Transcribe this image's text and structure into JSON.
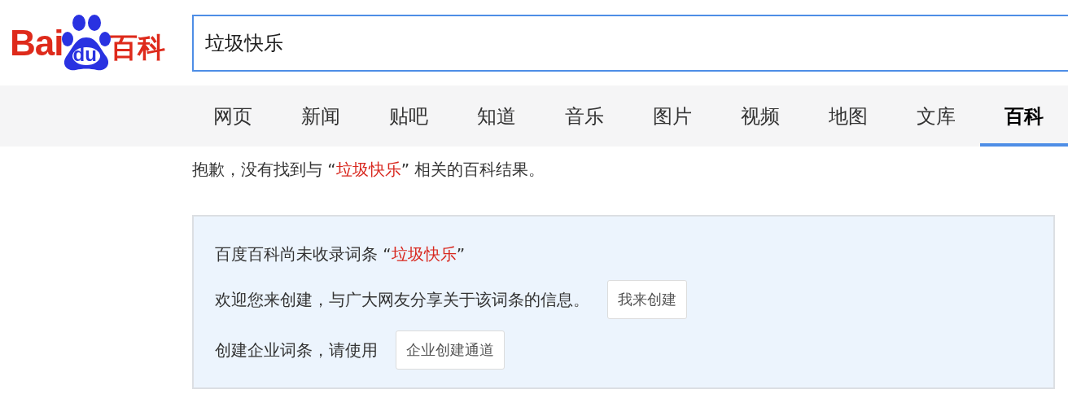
{
  "logo": {
    "text_left": "Bai",
    "paw_text": "du",
    "text_right": "百科"
  },
  "search": {
    "value": "垃圾快乐"
  },
  "tabs": [
    {
      "label": "网页",
      "selected": false
    },
    {
      "label": "新闻",
      "selected": false
    },
    {
      "label": "贴吧",
      "selected": false
    },
    {
      "label": "知道",
      "selected": false
    },
    {
      "label": "音乐",
      "selected": false
    },
    {
      "label": "图片",
      "selected": false
    },
    {
      "label": "视频",
      "selected": false
    },
    {
      "label": "地图",
      "selected": false
    },
    {
      "label": "文库",
      "selected": false
    },
    {
      "label": "百科",
      "selected": true
    }
  ],
  "message": {
    "before": "抱歉，没有找到与 “",
    "term": "垃圾快乐",
    "after": "” 相关的百科结果。"
  },
  "notice": {
    "title_before": "百度百科尚未收录词条 “",
    "title_term": "垃圾快乐",
    "title_after": "”",
    "invite_text": "欢迎您来创建，与广大网友分享关于该词条的信息。",
    "create_button": "我来创建",
    "enterprise_text": "创建企业词条，请使用",
    "enterprise_button": "企业创建通道"
  }
}
